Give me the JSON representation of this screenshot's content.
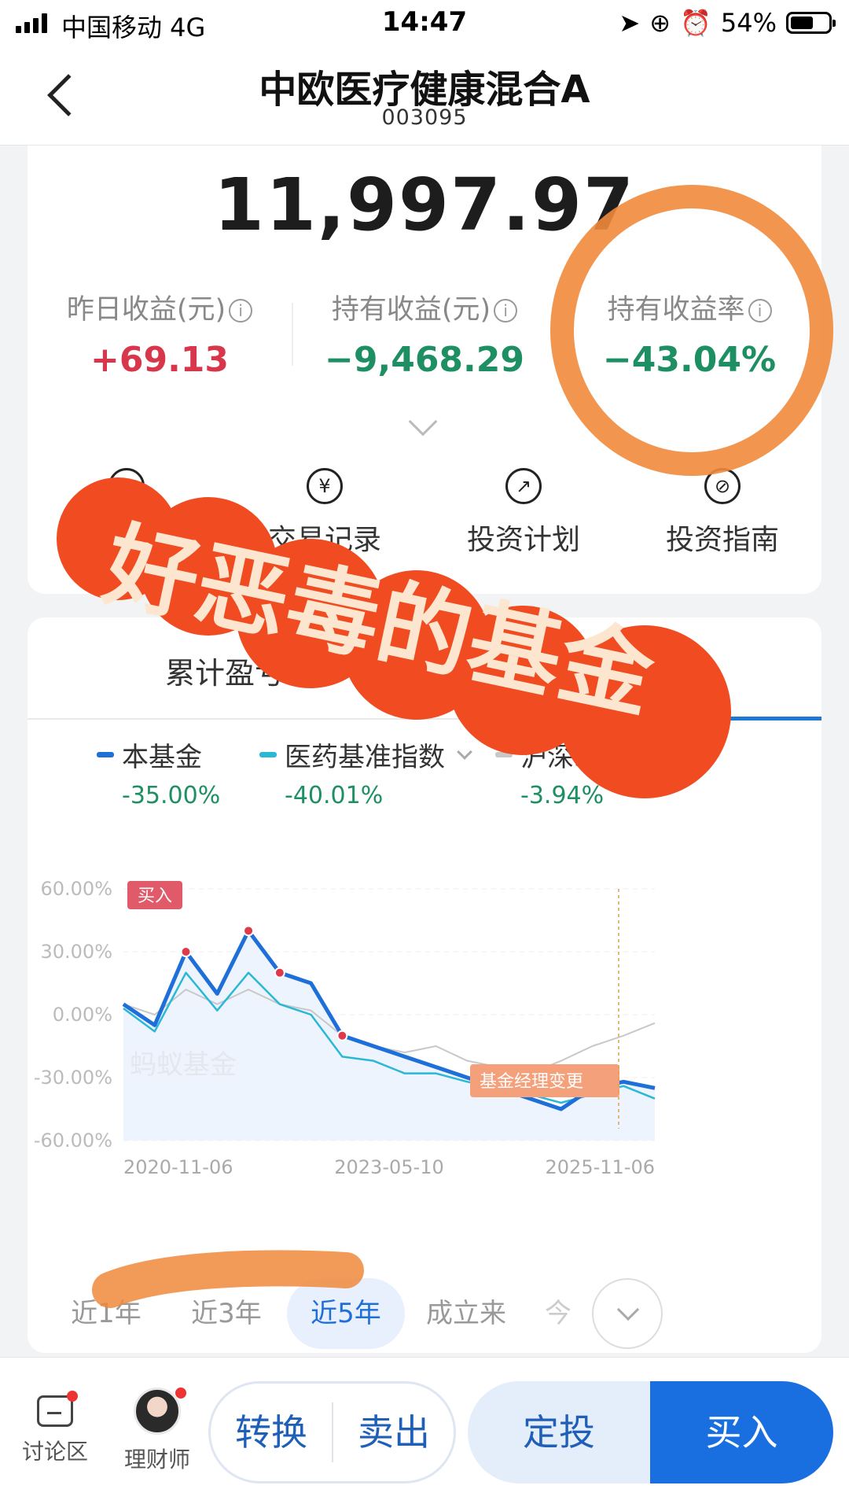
{
  "status_bar": {
    "carrier": "中国移动  4G",
    "time": "14:47",
    "battery": "54%"
  },
  "header": {
    "title": "中欧医疗健康混合A",
    "code": "003095"
  },
  "holding": {
    "amount": "11,997.97",
    "metrics": [
      {
        "label": "昨日收益(元)",
        "value": "+69.13",
        "tone": "red"
      },
      {
        "label": "持有收益(元)",
        "value": "−9,468.29",
        "tone": "green"
      },
      {
        "label": "持有收益率",
        "value": "−43.04%",
        "tone": "green"
      }
    ],
    "info_glyph": "i",
    "actions": [
      {
        "icon": "doc-icon",
        "glyph": "▤",
        "label": "易记录"
      },
      {
        "icon": "yen-icon",
        "glyph": "¥",
        "label": "交易记录"
      },
      {
        "icon": "trend-icon",
        "glyph": "↗",
        "label": "投资计划"
      },
      {
        "icon": "compass-icon",
        "glyph": "⊘",
        "label": "投资指南"
      }
    ]
  },
  "chart_section": {
    "tabs": [
      "累计盈亏"
    ],
    "legend": [
      {
        "name": "本基金",
        "value": "-35.00%",
        "color": "#1f6fd8"
      },
      {
        "name": "医药基准指数",
        "value": "-40.01%",
        "color": "#2ab8d6"
      },
      {
        "name": "沪深300",
        "value": "-3.94%",
        "color": "#c8c8c8"
      }
    ],
    "buy_tag": "买入",
    "watermark": "蚂蚁基金",
    "manager_change_tag": "基金经理变更",
    "periods": [
      "近1年",
      "近3年",
      "近5年",
      "成立来",
      "今"
    ],
    "active_period": "近5年"
  },
  "chart_data": {
    "type": "line",
    "x_labels": [
      "2020-11-06",
      "2023-05-10",
      "2025-11-06"
    ],
    "y_ticks": [
      "60.00%",
      "30.00%",
      "0.00%",
      "-30.00%",
      "-60.00%"
    ],
    "ylim": [
      -60,
      60
    ],
    "grid": true,
    "series": [
      {
        "name": "本基金",
        "values": [
          5,
          -5,
          30,
          10,
          40,
          20,
          15,
          -10,
          -15,
          -20,
          -25,
          -30,
          -35,
          -40,
          -45,
          -35,
          -32,
          -35
        ]
      },
      {
        "name": "医药基准指数",
        "values": [
          3,
          -8,
          20,
          2,
          20,
          5,
          0,
          -20,
          -22,
          -28,
          -28,
          -32,
          -35,
          -38,
          -42,
          -38,
          -34,
          -40
        ]
      },
      {
        "name": "沪深300",
        "values": [
          5,
          0,
          12,
          5,
          12,
          5,
          2,
          -10,
          -15,
          -18,
          -15,
          -22,
          -25,
          -28,
          -22,
          -15,
          -10,
          -4
        ]
      }
    ]
  },
  "bottom_bar": {
    "discuss": "讨论区",
    "advisor": "理财师",
    "convert": "转换",
    "sell": "卖出",
    "auto_invest": "定投",
    "buy": "买入"
  },
  "overlay": {
    "sticker_text": "好恶毒的基金"
  }
}
